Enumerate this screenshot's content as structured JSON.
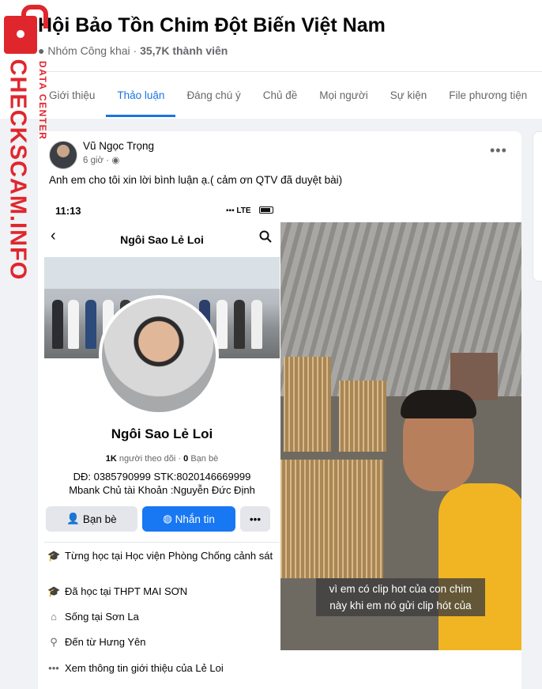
{
  "group": {
    "title": "Hội Bảo Tồn Chim Đột Biến Việt Nam",
    "privacy": "Nhóm Công khai",
    "separator": "·",
    "members": "35,7K thành viên"
  },
  "tabs": [
    {
      "label": "Giới thiệu",
      "active": false
    },
    {
      "label": "Thảo luận",
      "active": true
    },
    {
      "label": "Đáng chú ý",
      "active": false
    },
    {
      "label": "Chủ đề",
      "active": false
    },
    {
      "label": "Mọi người",
      "active": false
    },
    {
      "label": "Sự kiện",
      "active": false
    },
    {
      "label": "File phương tiện",
      "active": false
    }
  ],
  "watermark": {
    "brand": "CHECKSCAM.INFO",
    "sub": "DATA CENTER"
  },
  "post": {
    "author": "Vũ Ngọc Trọng",
    "time": "6 giờ ·",
    "more_icon": "•••",
    "text": "Anh em cho tôi xin lời bình luận ạ.( cảm ơn QTV đã duyệt bài)"
  },
  "phone": {
    "status_time": "11:13",
    "status_right": "LTE",
    "back_icon": "‹",
    "title": "Ngôi Sao Lẻ Loi",
    "name": "Ngôi Sao Lẻ Loi",
    "followers_count": "1K",
    "followers_label": "người theo dõi",
    "dot": "·",
    "friends_count": "0",
    "friends_label": "Bạn bè",
    "bio_line1": "DĐ: 0385790999 STK:8020146669999",
    "bio_line2": "Mbank Chủ tài Khoản :Nguyễn Đức Định",
    "buttons": {
      "friend": "Bạn bè",
      "message": "Nhắn tin",
      "more": "•••"
    },
    "info": [
      {
        "icon": "🎓",
        "text": "Từng học tại Học viện Phòng Chống cảnh sát"
      },
      {
        "icon": "🎓",
        "text": "Đã học tại THPT MAI SƠN"
      },
      {
        "icon": "⌂",
        "text": "Sống tại Sơn La"
      },
      {
        "icon": "⚲",
        "text": "Đến từ Hưng Yên"
      },
      {
        "icon": "•••",
        "text": "Xem thông tin giới thiệu của Lẻ Loi"
      }
    ]
  },
  "video": {
    "caption": "vì em có clip hot của con chim\nnày khi em nó gửi clip hót của",
    "mute_icon": "🔈"
  },
  "colors": {
    "accent": "#1b74e4",
    "messenger": "#1877f2",
    "watermark": "#e0262d",
    "background": "#f0f2f5"
  }
}
